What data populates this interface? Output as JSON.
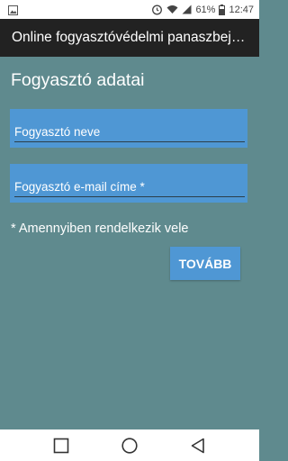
{
  "status_bar": {
    "battery": "61%",
    "time": "12:47",
    "icons": [
      "image-icon",
      "alarm-icon",
      "wifi-icon",
      "signal-icon",
      "battery-icon"
    ]
  },
  "app_bar": {
    "title": "Online fogyasztóvédelmi panaszbejelentő"
  },
  "form": {
    "heading": "Fogyasztó adatai",
    "name_placeholder": "Fogyasztó neve",
    "email_placeholder": "Fogyasztó e-mail címe *",
    "note": "* Amennyiben rendelkezik vele",
    "next_label": "TOVÁBB"
  },
  "nav_bar": {
    "icons": [
      "recent-apps-icon",
      "home-icon",
      "back-icon"
    ]
  },
  "colors": {
    "background": "#5f8a8e",
    "accent": "#4f97d4",
    "app_bar": "#222222"
  }
}
